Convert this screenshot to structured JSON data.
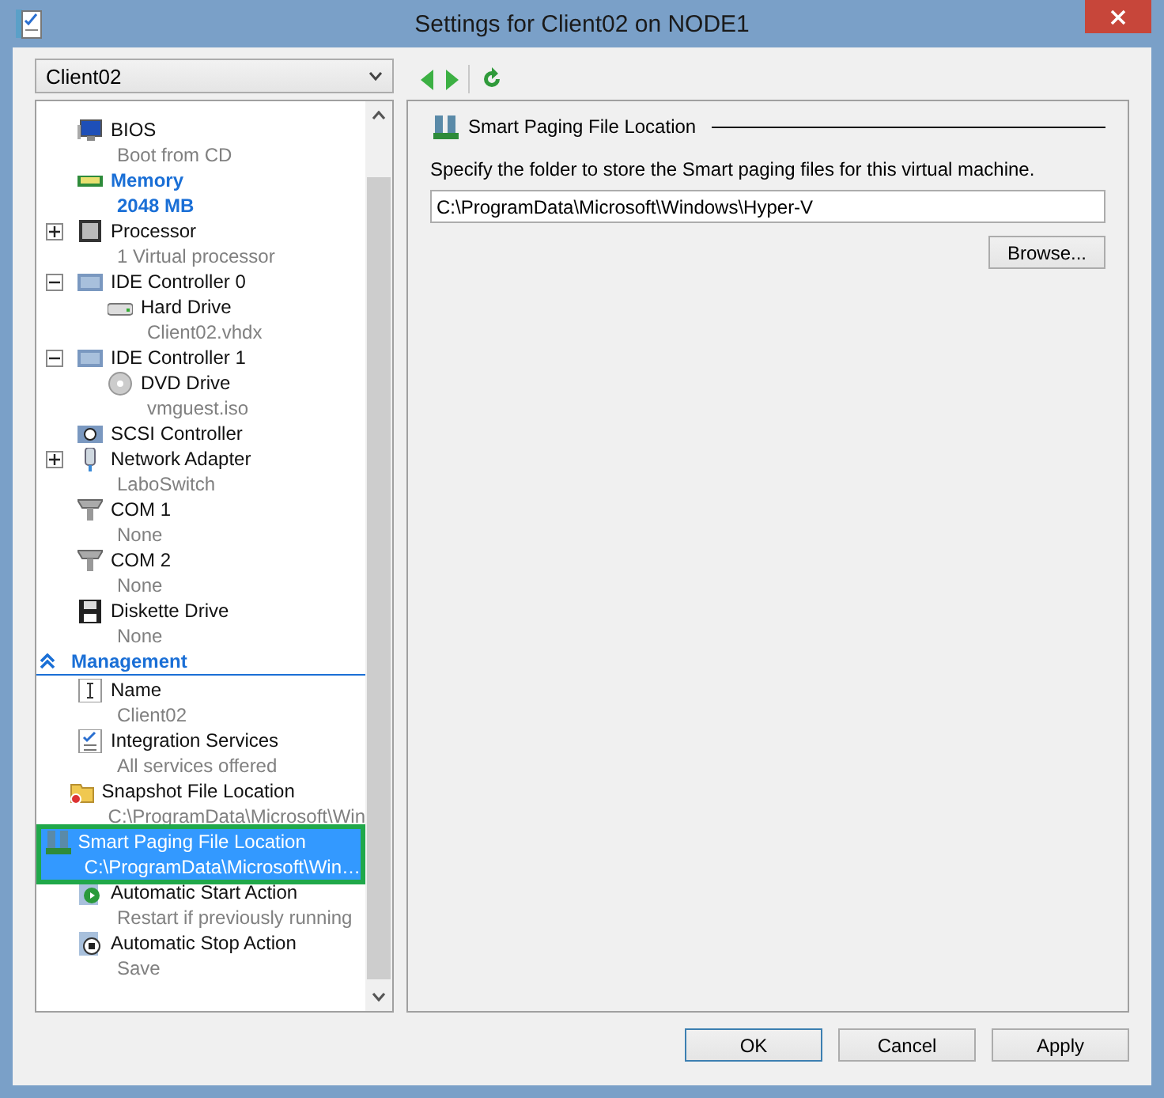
{
  "window": {
    "title": "Settings for Client02 on NODE1"
  },
  "vm_selector": {
    "value": "Client02"
  },
  "tree": [
    {
      "title": "BIOS",
      "subtitle": "Boot from CD",
      "kind": "bios",
      "highlighted": false,
      "selected": false
    },
    {
      "title": "Memory",
      "subtitle": "2048 MB",
      "kind": "memory",
      "highlighted": true,
      "selected": false
    },
    {
      "title": "Processor",
      "subtitle": "1 Virtual processor",
      "kind": "chip",
      "expanded": false,
      "highlighted": false,
      "selected": false
    },
    {
      "title": "IDE Controller 0",
      "kind": "controller",
      "expanded": true,
      "highlighted": false,
      "selected": false,
      "children": [
        {
          "title": "Hard Drive",
          "subtitle": "Client02.vhdx",
          "kind": "disk",
          "highlighted": false,
          "selected": false
        }
      ]
    },
    {
      "title": "IDE Controller 1",
      "kind": "controller",
      "expanded": true,
      "highlighted": false,
      "selected": false,
      "children": [
        {
          "title": "DVD Drive",
          "subtitle": "vmguest.iso",
          "kind": "dvd",
          "highlighted": false,
          "selected": false
        }
      ]
    },
    {
      "title": "SCSI Controller",
      "kind": "scsi",
      "highlighted": false,
      "selected": false
    },
    {
      "title": "Network Adapter",
      "subtitle": "LaboSwitch",
      "kind": "network",
      "expanded": false,
      "highlighted": false,
      "selected": false
    },
    {
      "title": "COM 1",
      "subtitle": "None",
      "kind": "com",
      "highlighted": false,
      "selected": false
    },
    {
      "title": "COM 2",
      "subtitle": "None",
      "kind": "com",
      "highlighted": false,
      "selected": false
    },
    {
      "title": "Diskette Drive",
      "subtitle": "None",
      "kind": "floppy",
      "highlighted": false,
      "selected": false
    }
  ],
  "management": {
    "title": "Management",
    "expanded": true,
    "items": [
      {
        "title": "Name",
        "subtitle": "Client02",
        "kind": "name",
        "highlighted": false,
        "selected": false
      },
      {
        "title": "Integration Services",
        "subtitle": "All services offered",
        "kind": "checklist",
        "highlighted": false,
        "selected": false
      },
      {
        "title": "Snapshot File Location",
        "subtitle": "C:\\ProgramData\\Microsoft\\Win",
        "kind": "folder",
        "highlighted": false,
        "selected": false
      },
      {
        "title": "Smart Paging File Location",
        "subtitle": "C:\\ProgramData\\Microsoft\\Win…",
        "kind": "paging",
        "highlighted": false,
        "selected": true
      },
      {
        "title": "Automatic Start Action",
        "subtitle": "Restart if previously running",
        "kind": "start",
        "highlighted": false,
        "selected": false
      },
      {
        "title": "Automatic Stop Action",
        "subtitle": "Save",
        "kind": "stop",
        "highlighted": false,
        "selected": false
      }
    ]
  },
  "detail": {
    "title": "Smart Paging File Location",
    "description": "Specify the folder to store the Smart paging files for this virtual machine.",
    "path": "C:\\ProgramData\\Microsoft\\Windows\\Hyper-V",
    "browse_button": "Browse..."
  },
  "buttons": [
    {
      "label": "OK",
      "default": true
    },
    {
      "label": "Cancel",
      "default": false
    },
    {
      "label": "Apply",
      "default": false
    }
  ]
}
